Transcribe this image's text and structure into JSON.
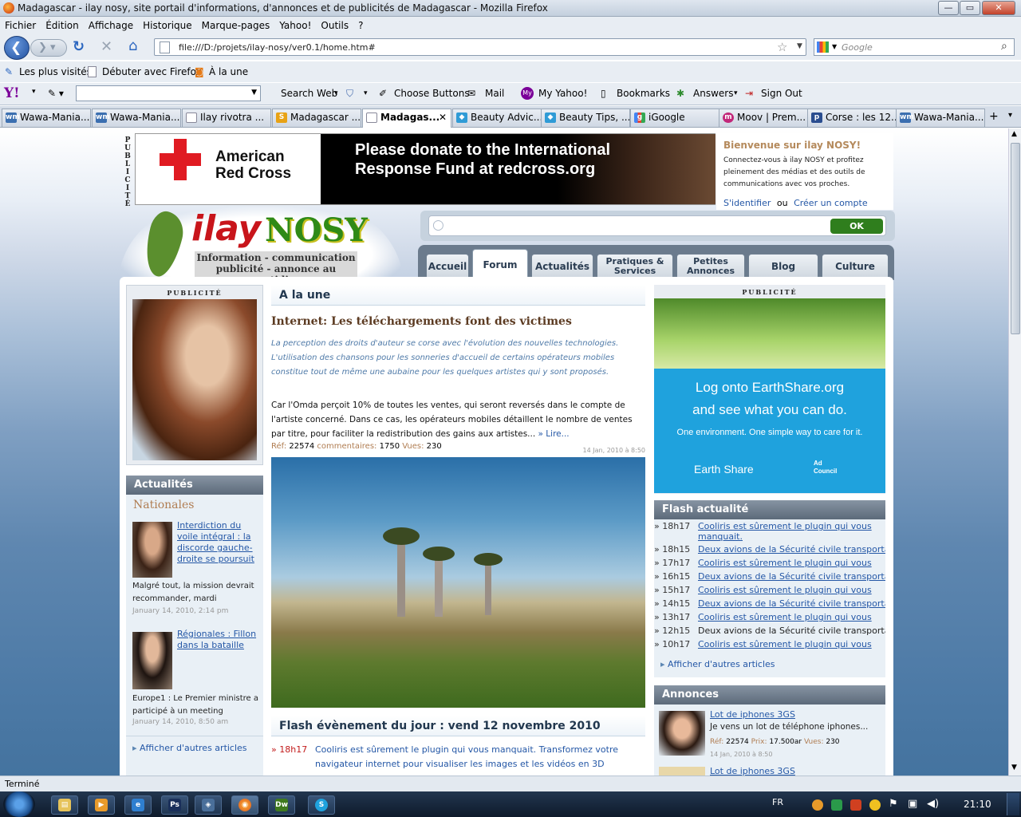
{
  "window": {
    "title": "Madagascar - ilay nosy, site portail d'informations, d'annonces et de publicités de Madagascar - Mozilla Firefox"
  },
  "menu": [
    "Fichier",
    "Édition",
    "Affichage",
    "Historique",
    "Marque-pages",
    "Yahoo!",
    "Outils",
    "?"
  ],
  "address": {
    "url": "file:///D:/projets/ilay-nosy/ver0.1/home.htm#"
  },
  "search": {
    "placeholder": "Google"
  },
  "bookmarks": [
    "Les plus visités",
    "Débuter avec Firefox",
    "À la une"
  ],
  "yahoo_toolbar": {
    "search_web": "Search Web",
    "choose_buttons": "Choose Buttons",
    "mail": "Mail",
    "my_yahoo": "My Yahoo!",
    "bookmarks": "Bookmarks",
    "answers": "Answers",
    "sign_out": "Sign Out"
  },
  "tabs": [
    {
      "label": "Wawa-Mania...",
      "icon": "wm"
    },
    {
      "label": "Wawa-Mania...",
      "icon": "wm"
    },
    {
      "label": "Ilay rivotra ...",
      "icon": "doc"
    },
    {
      "label": "Madagascar ...",
      "icon": "S"
    },
    {
      "label": "Madagas...",
      "icon": "doc",
      "active": true
    },
    {
      "label": "Beauty Advic...",
      "icon": "fish"
    },
    {
      "label": "Beauty Tips, ...",
      "icon": "fish"
    },
    {
      "label": "iGoogle",
      "icon": "g"
    },
    {
      "label": "Moov | Prem...",
      "icon": "m"
    },
    {
      "label": "Corse : les 12...",
      "icon": "p"
    },
    {
      "label": "Wawa-Mania...",
      "icon": "wm"
    }
  ],
  "page": {
    "publicite_label": "PUBLICITÉ",
    "banner": {
      "brand": "American Red Cross",
      "message": "Please donate to the International Response Fund at redcross.org"
    },
    "welcome": {
      "title": "Bienvenue sur ilay NOSY!",
      "text": "Connectez-vous à ilay NOSY et profitez pleinement des médias et des outils de communications avec vos proches.",
      "login": "S'identifier",
      "or": "ou",
      "register": "Créer un compte"
    },
    "logo": {
      "ilay": "ilay",
      "nosy": "NOSY",
      "tagline1": "Information - communication",
      "tagline2": "publicité - annonce au quotidien"
    },
    "site_search": {
      "ok": "OK"
    },
    "nav": [
      "Accueil",
      "Forum",
      "Actualités",
      "Pratiques & Services",
      "Petites Annonces",
      "Blog",
      "Culture"
    ],
    "left": {
      "pub_label": "PUBLICITÉ",
      "actualites_title": "Actualités",
      "nationales": "Nationales",
      "items": [
        {
          "link": "Interdiction du voile intégral : la discorde gauche-droite se poursuit",
          "text": "Malgré tout, la mission devrait recommander, mardi",
          "date": "January 14, 2010, 2:14 pm"
        },
        {
          "link": "Régionales : Fillon dans la bataille",
          "text": "Europe1 : Le Premier ministre a participé à un meeting",
          "date": "January 14, 2010, 8:50 am"
        }
      ],
      "more": "Afficher d'autres articles"
    },
    "center": {
      "alaune": "A la une",
      "headline": "Internet: Les téléchargements font des victimes",
      "lead": "La perception des droits d'auteur se corse avec l'évolution des nouvelles technologies. L'utilisation des chansons pour les sonneries d'accueil de certains opérateurs mobiles constitue tout de même une aubaine pour les quelques artistes qui y sont proposés.",
      "body": "Car l'Omda perçoit 10% de toutes les ventes, qui seront reversés dans le compte de l'artiste concerné. Dans ce cas, les opérateurs mobiles détaillent le nombre de ventes par titre, pour faciliter la redistribution des gains aux artistes...",
      "more": "» Lire...",
      "ref_label": "Réf:",
      "ref": "22574",
      "comments_label": "commentaires:",
      "comments": "1750",
      "views_label": "Vues:",
      "views": "230",
      "date": "14 Jan, 2010 à 8:50",
      "flash_title": "Flash évènement du jour : vend 12 novembre 2010",
      "flash_time": "18h17",
      "flash_text": "Cooliris est sûrement le plugin qui vous manquait. Transformez votre navigateur internet pour visualiser les images et les vidéos en 3D"
    },
    "right": {
      "pub_label": "PUBLICITÉ",
      "ad_line1": "Log onto EarthShare.org",
      "ad_line2": "and see what you can do.",
      "ad_line3": "One environment. One simple way to care for it.",
      "ad_brand": "Earth Share",
      "ad_council": "Ad Council",
      "flash_title": "Flash actualité",
      "flash": [
        {
          "time": "18h17",
          "text": "Cooliris est sûrement le plugin qui vous manquait."
        },
        {
          "time": "18h15",
          "text": "Deux avions de la Sécurité civile transportant"
        },
        {
          "time": "17h17",
          "text": "Cooliris est sûrement le plugin qui vous"
        },
        {
          "time": "16h15",
          "text": "Deux avions de la Sécurité civile transportant"
        },
        {
          "time": "15h17",
          "text": "Cooliris est sûrement le plugin qui vous"
        },
        {
          "time": "14h15",
          "text": "Deux avions de la Sécurité civile transportant"
        },
        {
          "time": "13h17",
          "text": "Cooliris est sûrement le plugin qui vous"
        },
        {
          "time": "12h15",
          "text": "Deux avions de la Sécurité civile transportant"
        },
        {
          "time": "10h17",
          "text": "Cooliris est sûrement le plugin qui vous"
        }
      ],
      "more": "Afficher d'autres articles",
      "annonces_title": "Annonces",
      "annonce": {
        "title": "Lot de iphones 3GS",
        "text": "Je vens un lot de téléphone iphones...",
        "ref_label": "Réf:",
        "ref": "22574",
        "price_label": "Prix:",
        "price": "17.500ar",
        "views_label": "Vues:",
        "views": "230",
        "date": "14 Jan, 2010 à 8:50"
      },
      "annonce2_title": "Lot de iphones 3GS"
    }
  },
  "status": "Terminé",
  "taskbar": {
    "lang": "FR",
    "clock": "21:10"
  }
}
